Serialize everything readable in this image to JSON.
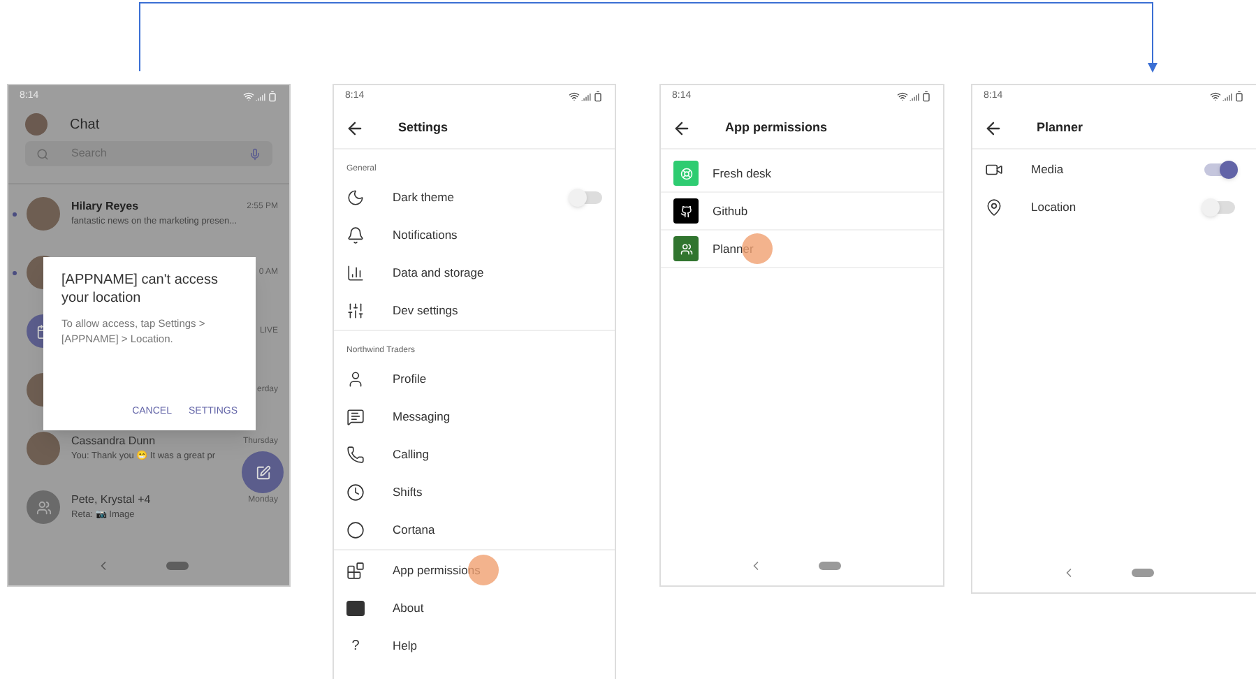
{
  "screens": [
    {
      "kind": "chat",
      "status_time": "8:14",
      "title": "Chat",
      "search": {
        "placeholder": "Search"
      },
      "rows": [
        {
          "name": "Hilary Reyes",
          "time": "2:55 PM",
          "preview": "fantastic news on the marketing presen...",
          "unread": true,
          "kind": "person"
        },
        {
          "time": "0 AM",
          "unread": true,
          "kind": "person"
        },
        {
          "time": "LIVE",
          "unread": false,
          "kind": "meeting"
        },
        {
          "time": "erday",
          "unread": false,
          "kind": "person"
        },
        {
          "name": "Cassandra Dunn",
          "time": "Thursday",
          "preview": "You: Thank you 😁 It was a great pr",
          "unread": false,
          "kind": "person"
        },
        {
          "name": "Pete, Krystal +4",
          "time": "Monday",
          "preview": "Reta: 📷 Image",
          "unread": false,
          "kind": "group"
        }
      ],
      "dialog": {
        "title": "[APPNAME] can't access your location",
        "body": "To allow access, tap Settings > [APPNAME] > Location.",
        "buttons": [
          "CANCEL",
          "SETTINGS"
        ]
      }
    },
    {
      "kind": "settings",
      "status_time": "8:14",
      "title": "Settings",
      "sections": [
        {
          "label": "General",
          "items": [
            {
              "label": "Dark theme",
              "kind": "toggle",
              "on": false
            },
            {
              "label": "Notifications",
              "kind": "link"
            },
            {
              "label": "Data and storage",
              "kind": "link"
            },
            {
              "label": "Dev settings",
              "kind": "link"
            }
          ]
        },
        {
          "label": "Northwind Traders",
          "items": [
            {
              "label": "Profile",
              "kind": "link"
            },
            {
              "label": "Messaging",
              "kind": "link"
            },
            {
              "label": "Calling",
              "kind": "link"
            },
            {
              "label": "Shifts",
              "kind": "link"
            },
            {
              "label": "Cortana",
              "kind": "link"
            }
          ]
        },
        {
          "items": [
            {
              "label": "App permissions",
              "kind": "link",
              "tapped": true
            },
            {
              "label": "About",
              "kind": "link"
            },
            {
              "label": "Help",
              "kind": "link",
              "icon_text": "?"
            }
          ]
        }
      ]
    },
    {
      "kind": "apps",
      "status_time": "8:14",
      "title": "App permissions",
      "apps": [
        {
          "label": "Fresh desk",
          "color": "#2ecc71",
          "tapped": false
        },
        {
          "label": "Github",
          "color": "#000000",
          "tapped": false
        },
        {
          "label": "Planner",
          "color": "#31752f",
          "tapped": true
        }
      ]
    },
    {
      "kind": "permissions",
      "status_time": "8:14",
      "title": "Planner",
      "items": [
        {
          "label": "Media",
          "on": true
        },
        {
          "label": "Location",
          "on": false
        }
      ]
    }
  ]
}
